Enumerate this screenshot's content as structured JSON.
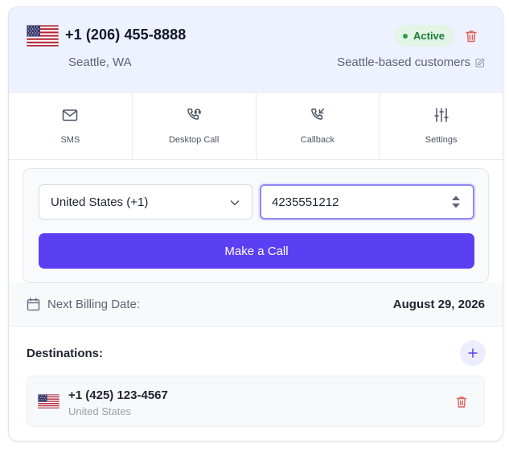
{
  "number": {
    "display": "+1 (206) 455-8888",
    "location": "Seattle, WA",
    "status": "Active",
    "note": "Seattle-based customers",
    "flag": "us-flag-icon"
  },
  "actions": [
    {
      "label": "SMS",
      "icon": "envelope-icon"
    },
    {
      "label": "Desktop Call",
      "icon": "phone-headset-icon"
    },
    {
      "label": "Callback",
      "icon": "phone-incoming-icon"
    },
    {
      "label": "Settings",
      "icon": "sliders-icon"
    }
  ],
  "call_form": {
    "country": "United States (+1)",
    "phone_value": "4235551212",
    "button_label": "Make a Call"
  },
  "billing": {
    "label": "Next Billing Date:",
    "date": "August 29, 2026"
  },
  "destinations": {
    "title": "Destinations:",
    "items": [
      {
        "number": "+1 (425) 123-4567",
        "country": "United States",
        "flag": "us-flag-icon"
      }
    ]
  },
  "colors": {
    "accent": "#5b3ff2",
    "header_bg": "#eef1fe",
    "active_bg": "#e3f5e6",
    "active_text": "#1b7a35",
    "danger": "#e0625c"
  }
}
